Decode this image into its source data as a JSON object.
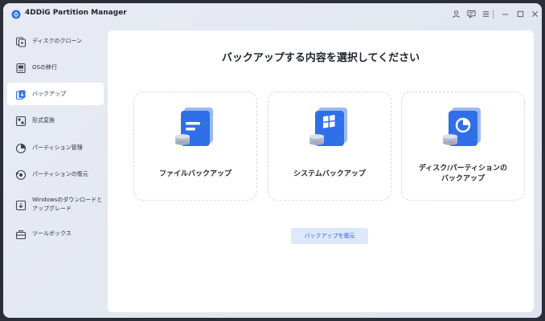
{
  "app": {
    "title": "4DDiG Partition Manager"
  },
  "sidebar": {
    "items": [
      {
        "label": "ディスクのクローン",
        "icon": "disk-clone-icon"
      },
      {
        "label": "OSの移行",
        "icon": "os-migration-icon"
      },
      {
        "label": "バックアップ",
        "icon": "backup-icon",
        "active": true
      },
      {
        "label": "形式変換",
        "icon": "format-convert-icon"
      },
      {
        "label": "パーティション管理",
        "icon": "partition-manage-icon"
      },
      {
        "label": "パーティションの復元",
        "icon": "partition-recovery-icon"
      },
      {
        "label": "Windowsのダウンロードと",
        "label2": "アップグレード",
        "icon": "windows-upgrade-icon"
      },
      {
        "label": "ツールボックス",
        "icon": "toolbox-icon"
      }
    ]
  },
  "main": {
    "heading": "バックアップする内容を選択してください",
    "cards": [
      {
        "label": "ファイルバックアップ",
        "icon": "file-backup-icon"
      },
      {
        "label": "システムバックアップ",
        "icon": "system-backup-icon"
      },
      {
        "label": "ディスク/パーティションの",
        "label2": "バックアップ",
        "icon": "disk-partition-backup-icon"
      }
    ],
    "restore_label": "バックアップを復元"
  },
  "colors": {
    "accent": "#2f6fe8",
    "active_bg": "#ffffff",
    "restore_bg": "#dde8fb"
  }
}
